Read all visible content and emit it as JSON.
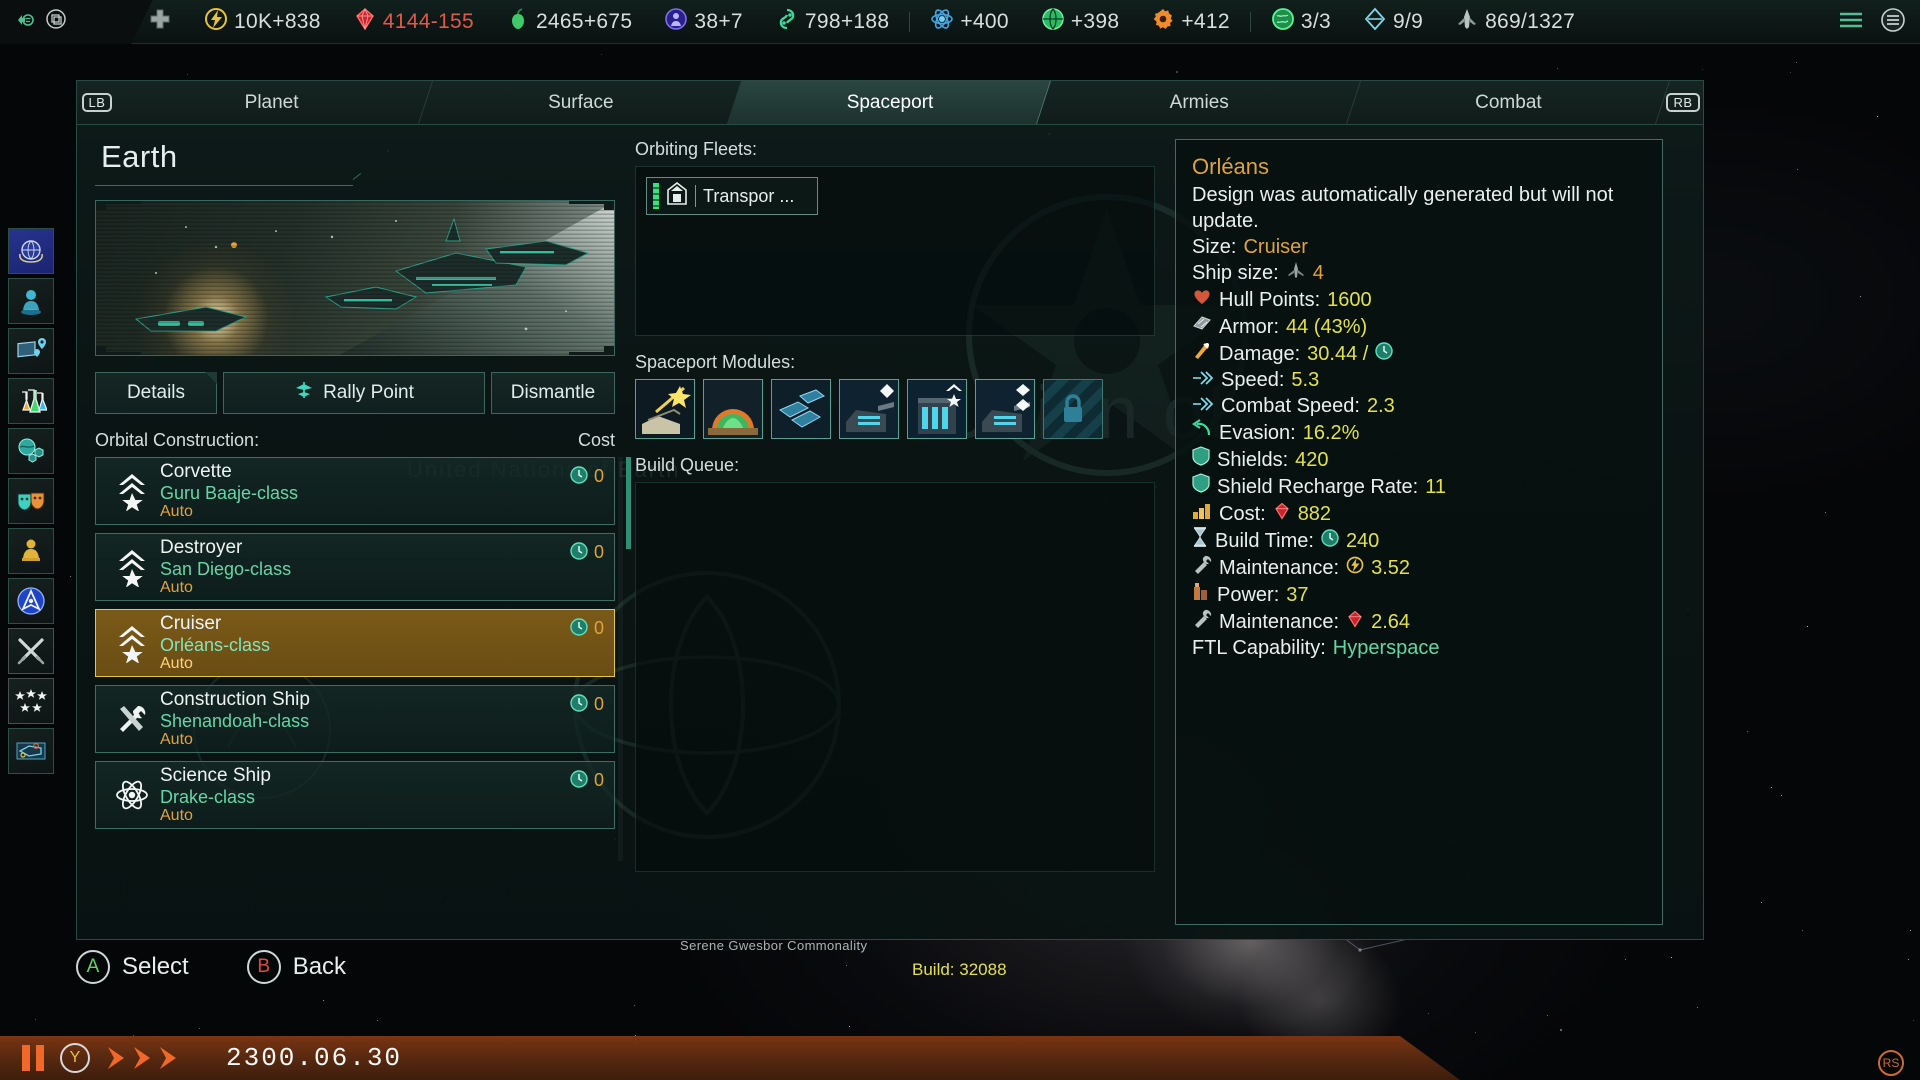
{
  "topbar": {
    "left_icons": [
      "migration-icon",
      "layers-icon"
    ],
    "resources": [
      {
        "icon": "medical-cross-icon",
        "value": "",
        "name": "health-resource"
      },
      {
        "icon": "energy-bolt-icon",
        "value": "10K+838",
        "name": "energy-resource"
      },
      {
        "icon": "minerals-gem-icon",
        "value": "4144-155",
        "name": "minerals-resource",
        "color": "#e05a4a"
      },
      {
        "icon": "food-apple-icon",
        "value": "2465+675",
        "name": "food-resource"
      },
      {
        "icon": "influence-icon",
        "value": "38+7",
        "name": "influence-resource"
      },
      {
        "icon": "unity-icon",
        "value": "798+188",
        "name": "unity-resource"
      },
      {
        "icon": "physics-atom-icon",
        "value": "+400",
        "name": "physics-research"
      },
      {
        "icon": "society-globe-icon",
        "value": "+398",
        "name": "society-research"
      },
      {
        "icon": "engineering-gear-icon",
        "value": "+412",
        "name": "engineering-research"
      },
      {
        "icon": "colony-globe-icon",
        "value": "3/3",
        "name": "colonies-counter"
      },
      {
        "icon": "starbase-diamond-icon",
        "value": "9/9",
        "name": "starbase-counter"
      },
      {
        "icon": "fleet-ship-icon",
        "value": "869/1327",
        "name": "naval-capacity"
      }
    ],
    "right_icons": [
      "menu-lines-icon",
      "options-circle-icon"
    ]
  },
  "sidebar": {
    "items": [
      {
        "name": "sidebar-item-empire",
        "icon": "un-globe-icon"
      },
      {
        "name": "sidebar-item-leaders",
        "icon": "hologram-leader-icon"
      },
      {
        "name": "sidebar-item-situation-log",
        "icon": "map-pins-icon"
      },
      {
        "name": "sidebar-item-research",
        "icon": "flasks-icon"
      },
      {
        "name": "sidebar-item-planets",
        "icon": "planet-hex-icon"
      },
      {
        "name": "sidebar-item-diplomacy",
        "icon": "masks-icon"
      },
      {
        "name": "sidebar-item-species",
        "icon": "alien-podium-icon"
      },
      {
        "name": "sidebar-item-federation",
        "icon": "federation-emblem-icon"
      },
      {
        "name": "sidebar-item-war",
        "icon": "crossed-swords-icon"
      },
      {
        "name": "sidebar-item-traditions",
        "icon": "five-stars-icon"
      },
      {
        "name": "sidebar-item-ship-designer",
        "icon": "blueprint-ship-icon"
      }
    ]
  },
  "tabbar": {
    "left_bumper": "LB",
    "right_bumper": "RB",
    "tabs": [
      {
        "label": "Planet",
        "active": false,
        "name": "tab-planet"
      },
      {
        "label": "Surface",
        "active": false,
        "name": "tab-surface"
      },
      {
        "label": "Spaceport",
        "active": true,
        "name": "tab-spaceport"
      },
      {
        "label": "Armies",
        "active": false,
        "name": "tab-armies"
      },
      {
        "label": "Combat",
        "active": false,
        "name": "tab-combat"
      }
    ]
  },
  "planet": {
    "title": "Earth",
    "buttons": [
      {
        "label": "Details",
        "name": "details-button",
        "icon": null
      },
      {
        "label": "Rally Point",
        "name": "rally-point-button",
        "icon": "rally-point-icon"
      },
      {
        "label": "Dismantle",
        "name": "dismantle-button",
        "icon": null
      }
    ]
  },
  "orbital_construction": {
    "header": "Orbital Construction:",
    "cost_header": "Cost",
    "items": [
      {
        "type": "Corvette",
        "ship_class": "Guru Baaje-class",
        "auto": "Auto",
        "cost": "0",
        "icon": "chevrons-star-icon",
        "selected": false,
        "name": "build-item-corvette"
      },
      {
        "type": "Destroyer",
        "ship_class": "San Diego-class",
        "auto": "Auto",
        "cost": "0",
        "icon": "chevrons-star-icon",
        "selected": false,
        "name": "build-item-destroyer"
      },
      {
        "type": "Cruiser",
        "ship_class": "Orléans-class",
        "auto": "Auto",
        "cost": "0",
        "icon": "chevrons-star-icon",
        "selected": true,
        "name": "build-item-cruiser"
      },
      {
        "type": "Construction Ship",
        "ship_class": "Shenandoah-class",
        "auto": "Auto",
        "cost": "0",
        "icon": "tools-icon",
        "selected": false,
        "name": "build-item-construction-ship"
      },
      {
        "type": "Science Ship",
        "ship_class": "Drake-class",
        "auto": "Auto",
        "cost": "0",
        "icon": "atom-icon",
        "selected": false,
        "name": "build-item-science-ship"
      }
    ]
  },
  "orbiting_fleets": {
    "header": "Orbiting Fleets:",
    "fleets": [
      {
        "label": "Transpor ...",
        "icon": "transport-ship-icon",
        "name": "fleet-chip-transport"
      }
    ]
  },
  "spaceport_modules": {
    "header": "Spaceport Modules:",
    "modules": [
      {
        "name": "module-slot-shipyard",
        "icon": "shipyard-module-icon",
        "badge": null,
        "locked": false
      },
      {
        "name": "module-slot-crew-quarters",
        "icon": "crew-quarters-module-icon",
        "badge": null,
        "locked": false
      },
      {
        "name": "module-slot-solar-panels",
        "icon": "solar-panel-module-icon",
        "badge": null,
        "locked": false
      },
      {
        "name": "module-slot-gun-battery-1",
        "icon": "gun-battery-module-icon",
        "badge": "diamond",
        "locked": false
      },
      {
        "name": "module-slot-hangar-bay",
        "icon": "hangar-bay-module-icon",
        "badge": "chevron-star",
        "locked": false
      },
      {
        "name": "module-slot-gun-battery-2",
        "icon": "gun-battery-module-icon",
        "badge": "double-diamond",
        "locked": false
      },
      {
        "name": "module-slot-locked",
        "icon": "lock-icon",
        "badge": null,
        "locked": true
      }
    ]
  },
  "build_queue": {
    "header": "Build Queue:",
    "items": []
  },
  "ship_details": {
    "name": "Orléans",
    "description": "Design was automatically generated but will not update.",
    "size_label": "Size:",
    "size_value": "Cruiser",
    "stats": [
      {
        "icon": null,
        "label": "Ship size:",
        "inline_icon": "ship-size-icon",
        "value": "4",
        "value_color": "#e0a33c",
        "name": "stat-ship-size"
      },
      {
        "icon": "heart-icon",
        "label": "Hull Points:",
        "inline_icon": null,
        "value": "1600",
        "value_color": "#e3e04a",
        "name": "stat-hull-points"
      },
      {
        "icon": "armor-plate-icon",
        "label": "Armor:",
        "inline_icon": null,
        "value": "44 (43%)",
        "value_color": "#e3e04a",
        "name": "stat-armor"
      },
      {
        "icon": "damage-icon",
        "label": "Damage:",
        "inline_icon": null,
        "value": "30.44 /",
        "value_color": "#e3e04a",
        "suffix_icon": "time-clock-icon",
        "name": "stat-damage"
      },
      {
        "icon": "speed-arrow-icon",
        "label": "Speed:",
        "inline_icon": null,
        "value": "5.3",
        "value_color": "#e3e04a",
        "name": "stat-speed"
      },
      {
        "icon": "speed-arrow-icon",
        "label": "Combat Speed:",
        "inline_icon": null,
        "value": "2.3",
        "value_color": "#e3e04a",
        "name": "stat-combat-speed"
      },
      {
        "icon": "evasion-arrow-icon",
        "label": "Evasion:",
        "inline_icon": null,
        "value": "16.2%",
        "value_color": "#e3e04a",
        "name": "stat-evasion"
      },
      {
        "icon": "shield-icon",
        "label": "Shields:",
        "inline_icon": null,
        "value": "420",
        "value_color": "#e3e04a",
        "name": "stat-shields"
      },
      {
        "icon": "shield-icon",
        "label": "Shield Recharge Rate:",
        "inline_icon": null,
        "value": "11",
        "value_color": "#e3e04a",
        "name": "stat-shield-recharge"
      },
      {
        "icon": "coins-icon",
        "label": "Cost:",
        "inline_icon": "minerals-gem-icon",
        "value": "882",
        "value_color": "#e3e04a",
        "name": "stat-cost"
      },
      {
        "icon": "hourglass-icon",
        "label": "Build Time:",
        "inline_icon": "time-clock-icon",
        "value": "240",
        "value_color": "#e3e04a",
        "name": "stat-build-time"
      },
      {
        "icon": "wrench-icon",
        "label": "Maintenance:",
        "inline_icon": "energy-bolt-icon",
        "value": "3.52",
        "value_color": "#e3e04a",
        "name": "stat-maintenance-energy"
      },
      {
        "icon": "power-plant-icon",
        "label": "Power:",
        "inline_icon": null,
        "value": "37",
        "value_color": "#e3e04a",
        "name": "stat-power"
      },
      {
        "icon": "wrench-icon",
        "label": "Maintenance:",
        "inline_icon": "minerals-gem-icon",
        "value": "2.64",
        "value_color": "#e3e04a",
        "name": "stat-maintenance-minerals"
      }
    ],
    "ftl_label": "FTL Capability:",
    "ftl_value": "Hyperspace"
  },
  "hints": [
    {
      "button": "A",
      "label": "Select",
      "color": "#5ed46a",
      "name": "hint-select"
    },
    {
      "button": "B",
      "label": "Back",
      "color": "#e04a3c",
      "name": "hint-back"
    }
  ],
  "empire_name": "Serene Gwesbor Commonality",
  "build_number": "Build: 32088",
  "statusbar": {
    "pause_icon": "pause-icon",
    "y_button": "Y",
    "speed_icon": "fast-forward-icon",
    "date": "2300.06.30",
    "rs_badge": "RS"
  },
  "colors": {
    "accent_green": "#63d6a8",
    "accent_orange": "#e0a33c",
    "value_yellow": "#e3e04a",
    "panel_border": "#3e6e63",
    "selected_row": "#e7c54b",
    "warning_red": "#e05a4a"
  }
}
